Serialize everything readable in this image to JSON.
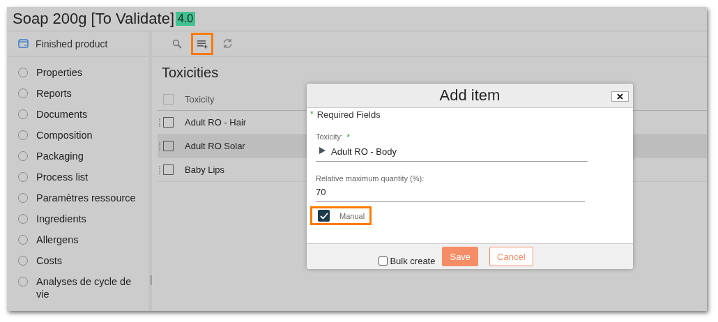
{
  "header": {
    "title": "Soap 200g [To Validate]",
    "version": "4.0"
  },
  "sidebar": {
    "title": "Finished product",
    "items": [
      {
        "label": "Properties",
        "selected": false
      },
      {
        "label": "Reports",
        "selected": false
      },
      {
        "label": "Documents",
        "selected": false
      },
      {
        "label": "Composition",
        "selected": false
      },
      {
        "label": "Packaging",
        "selected": false
      },
      {
        "label": "Process list",
        "selected": false
      },
      {
        "label": "Paramètres ressource",
        "selected": false
      },
      {
        "label": "Ingredients",
        "selected": false
      },
      {
        "label": "Allergens",
        "selected": false
      },
      {
        "label": "Costs",
        "selected": false
      },
      {
        "label": "Analyses de cycle de vie",
        "selected": false
      }
    ]
  },
  "toolbar": [
    {
      "kind": "search",
      "highlighted": false
    },
    {
      "kind": "add",
      "highlighted": true
    },
    {
      "kind": "refresh",
      "highlighted": false
    }
  ],
  "section": {
    "title": "Toxicities",
    "select_all_checked": false,
    "columns": [
      "Toxicity"
    ],
    "rows": [
      {
        "cells": [
          "Adult RO - Hair"
        ],
        "selected": false
      },
      {
        "cells": [
          "Adult RO Solar"
        ],
        "selected": true
      },
      {
        "cells": [
          "Baby Lips"
        ],
        "selected": false
      }
    ]
  },
  "dialog": {
    "title": "Add item",
    "required_marker": "*",
    "required_note": "Required Fields",
    "fields": [
      {
        "kind": "tree",
        "label": "Toxicity:",
        "marker": "*",
        "value": "Adult RO - Body"
      },
      {
        "kind": "text",
        "label": "Relative maximum quantity (%):",
        "value": "70"
      }
    ],
    "manual": {
      "label": "Manual",
      "checked": true,
      "highlighted": true
    },
    "bulk_create": {
      "label": "Bulk create",
      "checked": false
    },
    "buttons": [
      {
        "kind": "primary",
        "label": "Save"
      },
      {
        "kind": "secondary",
        "label": "Cancel"
      }
    ]
  }
}
